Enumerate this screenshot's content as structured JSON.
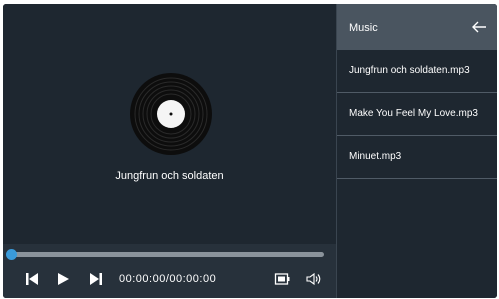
{
  "player": {
    "now_playing": "Jungfrun och soldaten",
    "time_display": "00:00:00/00:00:00",
    "progress": 0,
    "accent_color": "#3a9ad9",
    "icons": {
      "artwork": "vinyl-record-icon",
      "previous": "skip-previous-icon",
      "play": "play-icon",
      "next": "skip-next-icon",
      "screen": "screen-mode-icon",
      "volume": "volume-icon"
    }
  },
  "sidebar": {
    "title": "Music",
    "back_icon": "arrow-left-icon",
    "items": [
      {
        "label": "Jungfrun och soldaten.mp3"
      },
      {
        "label": "Make You Feel My Love.mp3"
      },
      {
        "label": "Minuet.mp3"
      }
    ]
  }
}
